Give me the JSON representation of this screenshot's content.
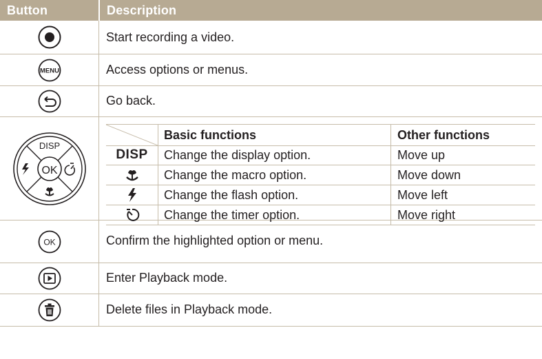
{
  "header": {
    "col_button": "Button",
    "col_description": "Description"
  },
  "rows": [
    {
      "description": "Start recording a video.",
      "icon": "record-icon"
    },
    {
      "description": "Access options or menus.",
      "icon": "menu-button-icon",
      "icon_text": "MENU"
    },
    {
      "description": "Go back.",
      "icon": "back-icon"
    },
    {
      "icon": "navigation-pad-icon",
      "pad_top": "DISP",
      "pad_center": "OK"
    },
    {
      "description": "Confirm the highlighted option or menu.",
      "icon": "ok-button-icon",
      "icon_text": "OK"
    },
    {
      "description": "Enter Playback mode.",
      "icon": "playback-icon"
    },
    {
      "description": "Delete files in Playback mode.",
      "icon": "delete-icon"
    }
  ],
  "nav_table": {
    "headers": {
      "basic": "Basic functions",
      "other": "Other functions"
    },
    "rows": [
      {
        "key": "DISP",
        "icon": "disp-label",
        "basic": "Change the display option.",
        "other": "Move up"
      },
      {
        "icon": "macro-icon",
        "basic": "Change the macro option.",
        "other": "Move down"
      },
      {
        "icon": "flash-icon",
        "basic": "Change the flash option.",
        "other": "Move left"
      },
      {
        "icon": "timer-icon",
        "basic": "Change the timer option.",
        "other": "Move right"
      }
    ]
  },
  "colors": {
    "header_bg": "#b7aa93",
    "rule": "#c6bca9",
    "text": "#231f20"
  }
}
